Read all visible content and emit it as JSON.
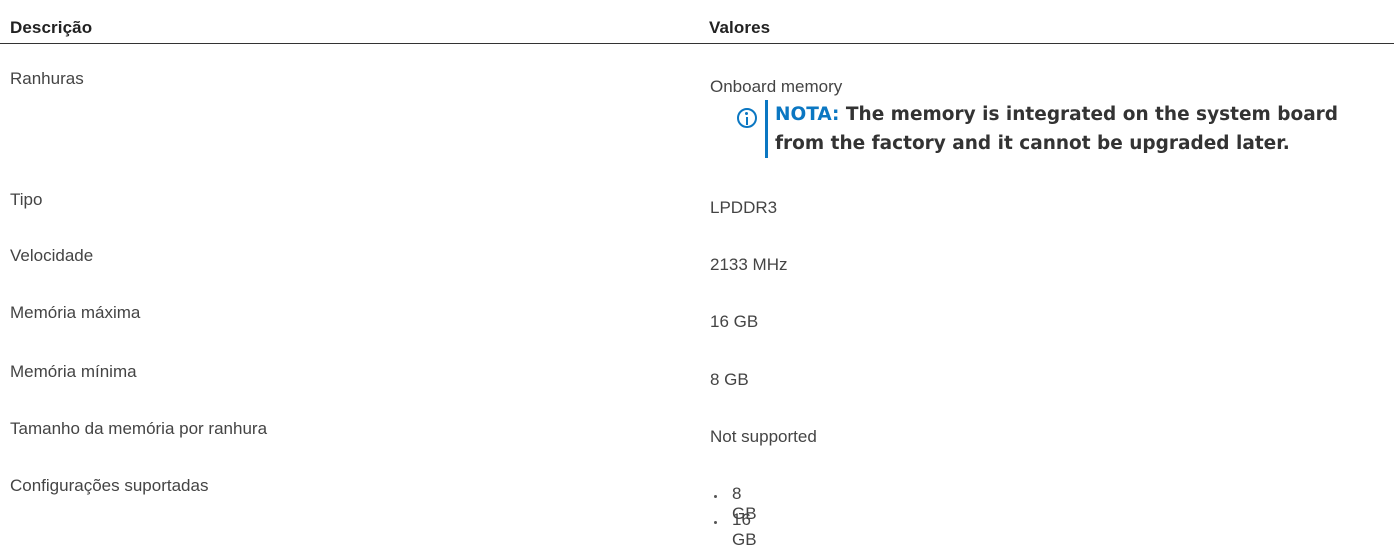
{
  "table": {
    "headers": {
      "description": "Descrição",
      "values": "Valores"
    },
    "rows": [
      {
        "label": "Ranhuras",
        "value": "Onboard memory"
      },
      {
        "label": "Tipo",
        "value": "LPDDR3"
      },
      {
        "label": "Velocidade",
        "value": "2133 MHz"
      },
      {
        "label": "Memória máxima",
        "value": "16 GB"
      },
      {
        "label": "Memória mínima",
        "value": "8 GB"
      },
      {
        "label": "Tamanho da memória por ranhura",
        "value": "Not supported"
      },
      {
        "label": "Configurações suportadas",
        "items": [
          "8 GB",
          "16 GB"
        ]
      }
    ]
  },
  "note": {
    "label": "NOTA:",
    "text": "The memory is integrated on the system board from the factory and it cannot be upgraded later.",
    "icon": "info-icon",
    "accent_color": "#0b77c2"
  }
}
